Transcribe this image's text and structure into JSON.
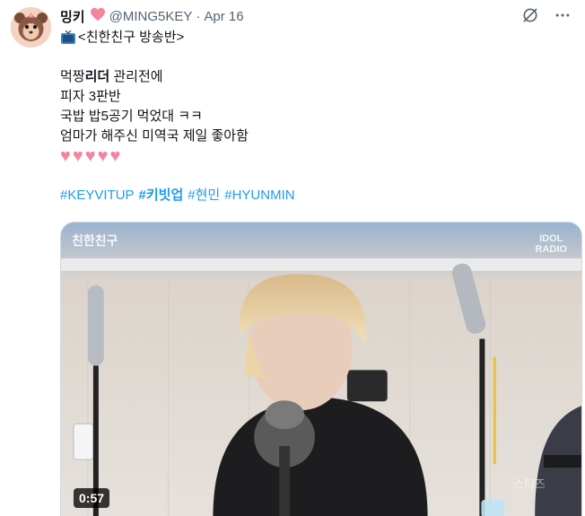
{
  "tweet": {
    "author_name": "밍키",
    "handle": "@MING5KEY",
    "separator": "·",
    "date": "Apr 16",
    "name_badge_icon": "heart-icon",
    "lines": {
      "title": "<친한친구 방송반>",
      "l1_pre": "먹짱",
      "l1_bold": "리더",
      "l1_post": " 관리전에",
      "l2": "피자 3판반",
      "l3": "국밥 밥5공기 먹었대 ㅋㅋ",
      "l4": "엄마가 해주신 미역국 제일 좋아함",
      "hearts": "♥♥♥♥♥"
    },
    "hashtags": [
      {
        "text": "#KEYVITUP",
        "bold": false
      },
      {
        "text": "#키빗업",
        "bold": true
      },
      {
        "text": "#현민",
        "bold": false
      },
      {
        "text": "#HYUNMIN",
        "bold": false
      }
    ],
    "media": {
      "duration": "0:57",
      "show_logo": "친한친구",
      "radio_logo_1": "IDOL",
      "radio_logo_2": "RADIO",
      "watermark": "스티즈"
    }
  },
  "colors": {
    "link": "#1d9bf0",
    "secondary_text": "#536471",
    "heart": "#f4859f"
  }
}
